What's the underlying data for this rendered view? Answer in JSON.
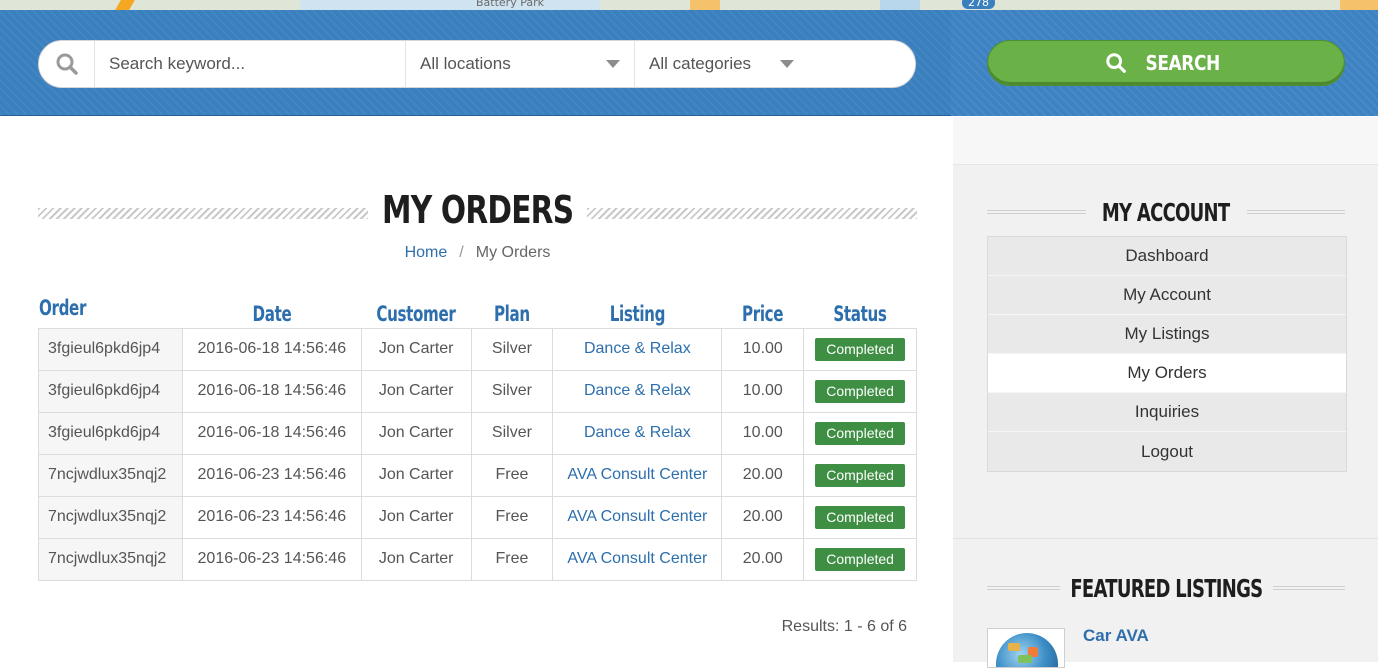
{
  "map": {
    "labels": [
      "Battery Park",
      "278"
    ]
  },
  "search": {
    "keyword_placeholder": "Search keyword...",
    "location_selected": "All locations",
    "category_selected": "All categories",
    "button_label": "SEARCH"
  },
  "page": {
    "title": "MY ORDERS",
    "breadcrumb": {
      "home": "Home",
      "separator": "/",
      "current": "My Orders"
    }
  },
  "orders": {
    "headers": {
      "order": "Order",
      "date": "Date",
      "customer": "Customer",
      "plan": "Plan",
      "listing": "Listing",
      "price": "Price",
      "status": "Status"
    },
    "rows": [
      {
        "order": "3fgieul6pkd6jp4",
        "date": "2016-06-18 14:56:46",
        "customer": "Jon Carter",
        "plan": "Silver",
        "listing": "Dance & Relax",
        "price": "10.00",
        "status": "Completed"
      },
      {
        "order": "3fgieul6pkd6jp4",
        "date": "2016-06-18 14:56:46",
        "customer": "Jon Carter",
        "plan": "Silver",
        "listing": "Dance & Relax",
        "price": "10.00",
        "status": "Completed"
      },
      {
        "order": "3fgieul6pkd6jp4",
        "date": "2016-06-18 14:56:46",
        "customer": "Jon Carter",
        "plan": "Silver",
        "listing": "Dance & Relax",
        "price": "10.00",
        "status": "Completed"
      },
      {
        "order": "7ncjwdlux35nqj2",
        "date": "2016-06-23 14:56:46",
        "customer": "Jon Carter",
        "plan": "Free",
        "listing": "AVA Consult Center",
        "price": "20.00",
        "status": "Completed"
      },
      {
        "order": "7ncjwdlux35nqj2",
        "date": "2016-06-23 14:56:46",
        "customer": "Jon Carter",
        "plan": "Free",
        "listing": "AVA Consult Center",
        "price": "20.00",
        "status": "Completed"
      },
      {
        "order": "7ncjwdlux35nqj2",
        "date": "2016-06-23 14:56:46",
        "customer": "Jon Carter",
        "plan": "Free",
        "listing": "AVA Consult Center",
        "price": "20.00",
        "status": "Completed"
      }
    ],
    "results_text": "Results: 1 - 6 of 6"
  },
  "sidebar": {
    "account_title": "MY ACCOUNT",
    "account_items": [
      {
        "label": "Dashboard",
        "active": false
      },
      {
        "label": "My Account",
        "active": false
      },
      {
        "label": "My Listings",
        "active": false
      },
      {
        "label": "My Orders",
        "active": true
      },
      {
        "label": "Inquiries",
        "active": false
      },
      {
        "label": "Logout",
        "active": false
      }
    ],
    "featured_title": "FEATURED LISTINGS",
    "featured_items": [
      {
        "name": "Car AVA",
        "thumb_icon": "globe-thumbnail-icon"
      }
    ]
  },
  "colors": {
    "header_blue": "#3a7fbe",
    "link_blue": "#2d6fad",
    "search_green": "#6ab147",
    "status_green": "#3e8e43"
  }
}
